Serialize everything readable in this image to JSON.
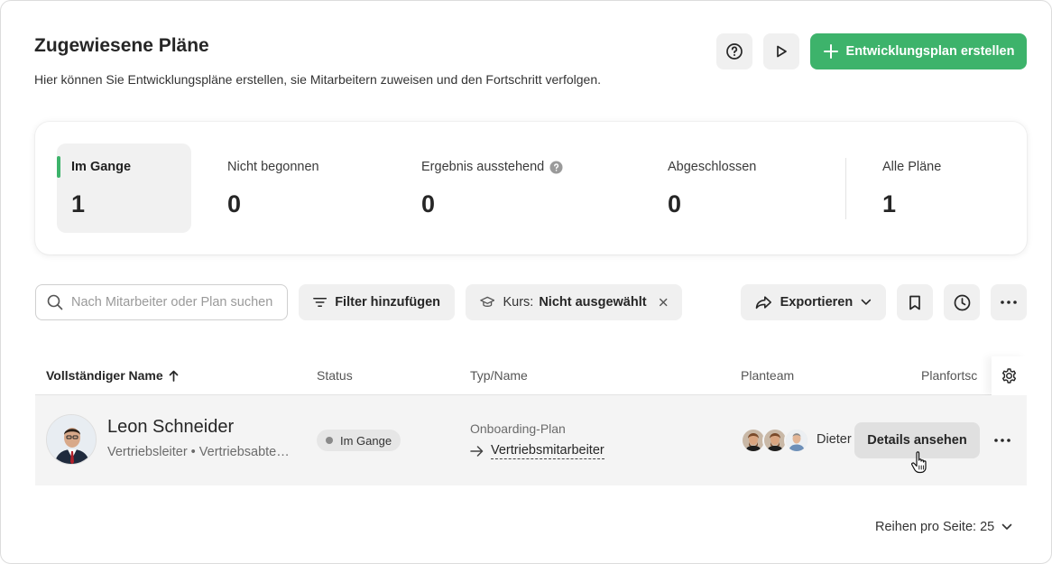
{
  "header": {
    "title": "Zugewiesene Pläne",
    "subtitle": "Hier können Sie Entwicklungspläne erstellen, sie Mitarbeitern zuweisen und den Fortschritt verfolgen.",
    "create_button_label": "Entwicklungsplan erstellen",
    "help_icon": "help-circle-icon",
    "play_icon": "play-icon"
  },
  "stats": [
    {
      "label": "Im Gange",
      "value": "1",
      "active": true
    },
    {
      "label": "Nicht begonnen",
      "value": "0",
      "active": false
    },
    {
      "label": "Ergebnis ausstehend",
      "value": "0",
      "active": false,
      "info_icon": "help-circle-icon"
    },
    {
      "label": "Abgeschlossen",
      "value": "0",
      "active": false
    },
    {
      "label": "Alle Pläne",
      "value": "1",
      "active": false
    }
  ],
  "toolbar": {
    "search_placeholder": "Nach Mitarbeiter oder Plan suchen",
    "filter_label": "Filter hinzufügen",
    "course_chip_key": "Kurs:",
    "course_chip_value": "Nicht ausgewählt",
    "export_label": "Exportieren"
  },
  "table": {
    "columns": {
      "name": "Vollständiger Name",
      "status": "Status",
      "type": "Typ/Name",
      "team": "Planteam",
      "progress": "Planfortschritt"
    },
    "sort": {
      "column": "name",
      "direction": "ascending"
    },
    "rows": [
      {
        "name": "Leon Schneider",
        "subtitle": "Vertriebsleiter • Vertriebsabteilung",
        "status": "Im Gange",
        "plan_type": "Onboarding-Plan",
        "plan_name": "Vertriebsmitarbeiter",
        "team_name": "Dieter",
        "details_label": "Details ansehen"
      }
    ]
  },
  "pagination": {
    "rows_per_page_label": "Reihen pro Seite: 25"
  },
  "colors": {
    "accent": "#3db36b",
    "chip_bg": "#f0f0f0",
    "row_bg": "#f4f4f4"
  }
}
